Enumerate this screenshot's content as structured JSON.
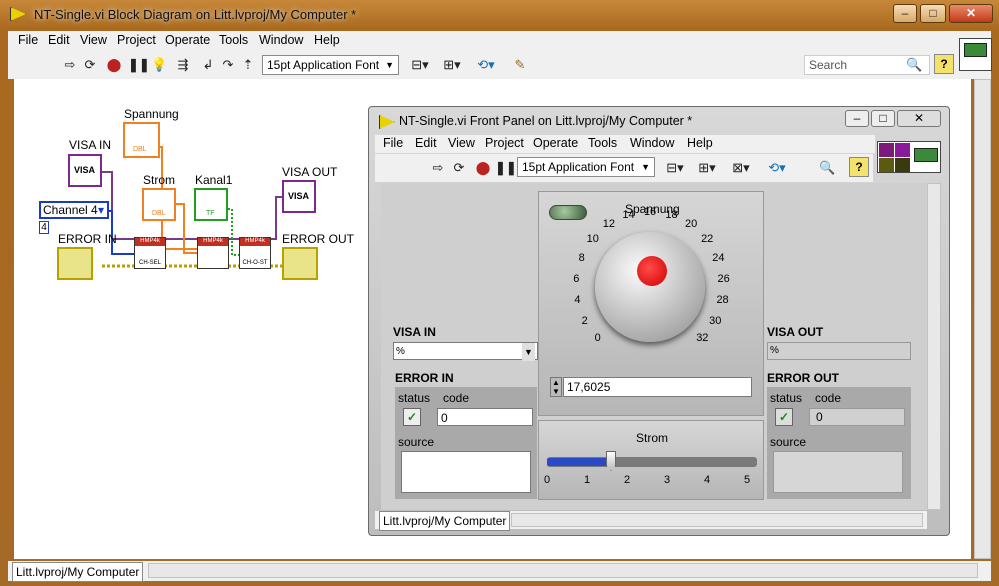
{
  "main_window": {
    "title": "NT-Single.vi Block Diagram on Litt.lvproj/My Computer *",
    "menus": [
      "File",
      "Edit",
      "View",
      "Project",
      "Operate",
      "Tools",
      "Window",
      "Help"
    ],
    "font_selector": "15pt Application Font",
    "search_placeholder": "Search",
    "status_context": "Litt.lvproj/My Computer"
  },
  "block_diagram": {
    "visa_in_label": "VISA IN",
    "visa_node_text": "VISA",
    "channel_control": "Channel 4",
    "channel_constant": "4",
    "error_in_label": "ERROR IN",
    "spannung_label": "Spannung",
    "strom_label": "Strom",
    "kanal_label": "Kanal1",
    "visa_out_label": "VISA OUT",
    "error_out_label": "ERROR OUT",
    "subvi1_top": "HMP4k",
    "subvi1_bottom": "CH-SEL",
    "subvi2_top": "HMP4k",
    "subvi3_top": "HMP4k",
    "subvi3_bottom": "CH-O-ST",
    "dbl_tag": "DBL",
    "tf_tag": "TF"
  },
  "front_panel": {
    "title": "NT-Single.vi Front Panel on Litt.lvproj/My Computer *",
    "menus": [
      "File",
      "Edit",
      "View",
      "Project",
      "Operate",
      "Tools",
      "Window",
      "Help"
    ],
    "font_selector": "15pt Application Font",
    "visa_in_label": "VISA IN",
    "visa_in_value": "",
    "error_in_label": "ERROR IN",
    "status_label": "status",
    "code_label": "code",
    "source_label": "source",
    "error_in_code": "0",
    "visa_out_label": "VISA OUT",
    "error_out_label": "ERROR OUT",
    "error_out_code": "0",
    "knob_label": "Spannung",
    "knob_ticks": [
      "0",
      "2",
      "4",
      "6",
      "8",
      "10",
      "12",
      "14",
      "16",
      "18",
      "20",
      "22",
      "24",
      "26",
      "28",
      "30",
      "32"
    ],
    "knob_value": "17,6025",
    "slider_label": "Strom",
    "slider_ticks": [
      "0",
      "1",
      "2",
      "3",
      "4",
      "5"
    ],
    "slider_value": 1.6,
    "status_context": "Litt.lvproj/My Computer"
  }
}
